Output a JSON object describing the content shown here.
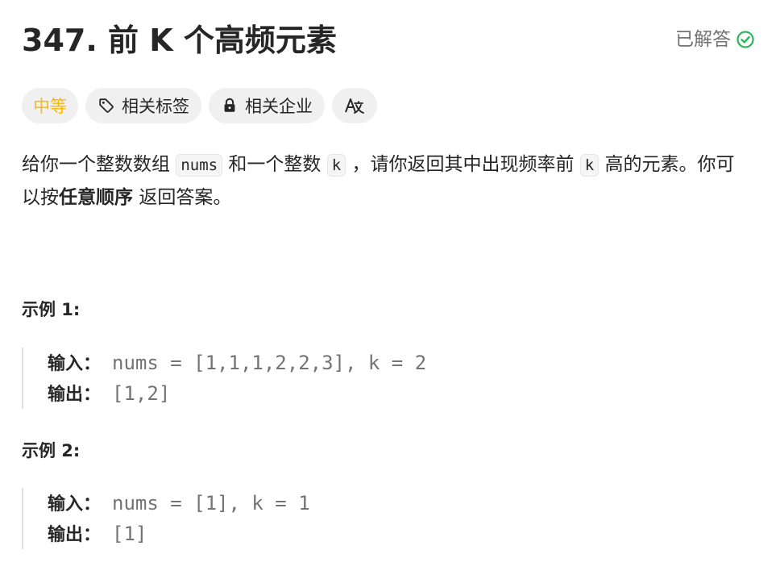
{
  "problem": {
    "title": "347. 前 K 个高频元素",
    "status": "已解答"
  },
  "tags": {
    "difficulty": "中等",
    "related_tags": "相关标签",
    "related_companies": "相关企业"
  },
  "description": {
    "p1": "给你一个整数数组",
    "code_nums": "nums",
    "p2": "和一个整数",
    "code_k1": "k",
    "p3": "，请你返回其中出现频率前",
    "code_k2": "k",
    "p4": "高的元素。你可以按",
    "bold": "任意顺序",
    "p5": "返回答案。"
  },
  "examples": [
    {
      "title": "示例 1:",
      "input_label": "输入：",
      "input": "nums = [1,1,1,2,2,3], k = 2",
      "output_label": "输出：",
      "output": "[1,2]"
    },
    {
      "title": "示例 2:",
      "input_label": "输入：",
      "input": "nums = [1], k = 1",
      "output_label": "输出：",
      "output": "[1]"
    }
  ],
  "colors": {
    "accent_green": "#2db55d",
    "difficulty_medium": "#ffb800"
  },
  "icons": {
    "solved": "check-circle-icon",
    "tags": "tag-icon",
    "companies": "lock-icon",
    "translate": "translate-icon"
  }
}
